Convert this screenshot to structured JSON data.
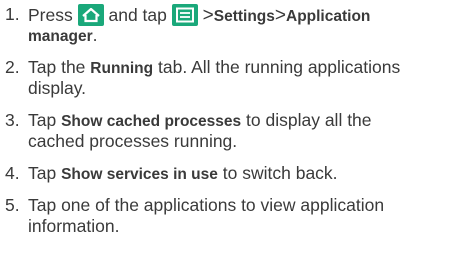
{
  "colors": {
    "icon_bg": "#1aa87a",
    "text": "#3a3a3a"
  },
  "icons": {
    "home": "home-icon",
    "menu": "menu-icon"
  },
  "steps": [
    {
      "num": "1.",
      "t1": "Press",
      "t2": "and tap",
      "sep1": ">",
      "b1": "Settings",
      "sep2": ">",
      "b2a": "Application",
      "b2b": "manager",
      "end": "."
    },
    {
      "num": "2.",
      "t1": "Tap the",
      "b1": "Running",
      "t2": "tab. All the running applications",
      "t3": "display."
    },
    {
      "num": "3.",
      "t1": "Tap",
      "b1": "Show cached processes",
      "t2": "to display all the",
      "t3": "cached processes running."
    },
    {
      "num": "4.",
      "t1": "Tap",
      "b1": "Show services in use",
      "t2": "to switch back."
    },
    {
      "num": "5.",
      "t1": "Tap one of the applications to view application",
      "t2": "information."
    }
  ]
}
